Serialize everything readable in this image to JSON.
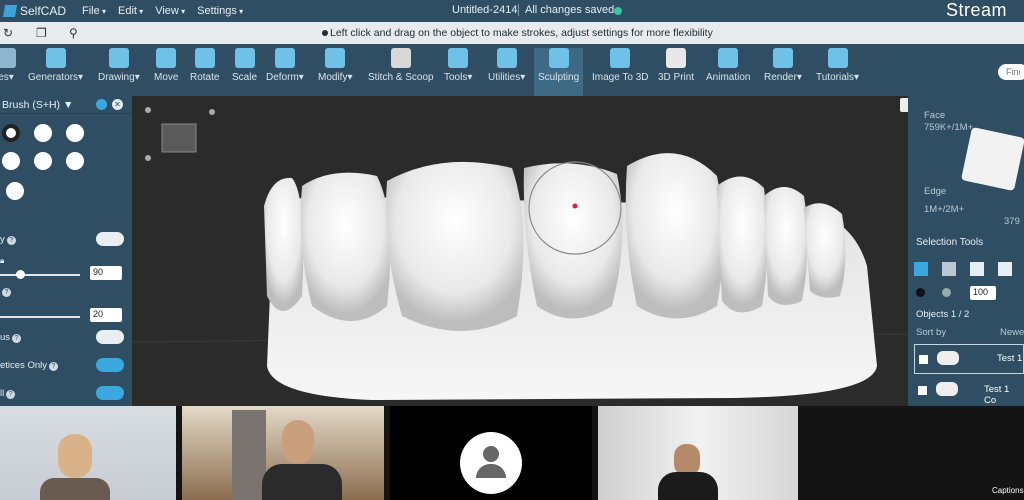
{
  "app": {
    "name": "SelfCAD",
    "document_title": "Untitled-2414",
    "save_status": "All changes saved",
    "stream_logo": "Stream"
  },
  "menu": {
    "items": [
      "File",
      "Edit",
      "View",
      "Settings"
    ]
  },
  "hint": {
    "text": "Left click and drag on the object to make strokes, adjust settings for more flexibility"
  },
  "toolbar": {
    "items": [
      {
        "label": "es",
        "arrow": true
      },
      {
        "label": "Generators",
        "arrow": true
      },
      {
        "label": "Drawing",
        "arrow": true
      },
      {
        "label": "Move"
      },
      {
        "label": "Rotate"
      },
      {
        "label": "Scale"
      },
      {
        "label": "Deform",
        "arrow": true
      },
      {
        "label": "Modify",
        "arrow": true
      },
      {
        "label": "Stitch & Scoop"
      },
      {
        "label": "Tools",
        "arrow": true
      },
      {
        "label": "Utilities",
        "arrow": true
      },
      {
        "label": "Sculpting",
        "active": true
      },
      {
        "label": "Image To 3D"
      },
      {
        "label": "3D Print"
      },
      {
        "label": "Animation"
      },
      {
        "label": "Render",
        "arrow": true
      },
      {
        "label": "Tutorials",
        "arrow": true
      }
    ],
    "find_placeholder": "Find"
  },
  "left_panel": {
    "title": "Brush (S+H) ▼",
    "rows": [
      {
        "label": "y",
        "type": "toggle",
        "on": false
      },
      {
        "label": "",
        "type": "slider",
        "value": "90",
        "fill": 0.2
      },
      {
        "label": "",
        "type": "slider",
        "value": "20",
        "fill": 1.0
      },
      {
        "label": "us",
        "type": "toggle",
        "on": false
      },
      {
        "label": "etices Only",
        "type": "toggle",
        "on": true
      },
      {
        "label": "ll",
        "type": "toggle",
        "on": true
      }
    ]
  },
  "right_panel": {
    "face_label": "Face",
    "face_count": "759K+/1M+",
    "edge_label": "Edge",
    "edge_count": "1M+/2M+",
    "extra_count": "379",
    "selection_title": "Selection Tools",
    "opacity_value": "100",
    "objects_label": "Objects 1 / 2",
    "sort_label": "Sort by",
    "sort_value": "Newes",
    "objects": [
      {
        "name": "Test 1",
        "selected": true
      },
      {
        "name": "Test 1 Co",
        "selected": true
      }
    ]
  },
  "bottom": {
    "captions_label": "Captions"
  },
  "colors": {
    "toolbar_bg": "#2f4e63",
    "accent": "#3aa7df",
    "viewport_bg": "#2b2b2b"
  }
}
